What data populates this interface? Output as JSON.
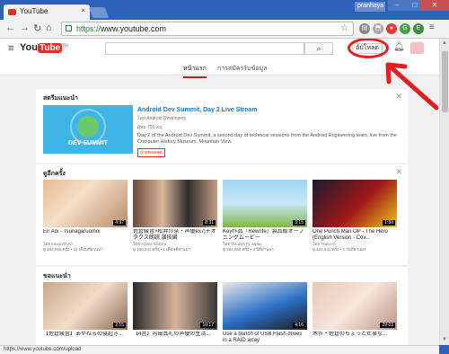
{
  "browser": {
    "tab_title": "YouTube",
    "tab_close": "×",
    "user_name": "pranhaya",
    "url_scheme": "https://",
    "url_rest": "www.youtube.com",
    "status_url": "https://www.youtube.com/upload",
    "window_minimize": "–",
    "window_maximize": "□",
    "window_close": "✕"
  },
  "masthead": {
    "logo_you": "You",
    "logo_tube": "Tube",
    "logo_country": "TH",
    "search_placeholder": "",
    "upload_label": "อัปโหลด"
  },
  "subnav": {
    "home": "หน้าแรก",
    "subscriptions": "การสมัครรับข้อมูล"
  },
  "recommended": {
    "title": "สตรีมแนะนำ",
    "featured": {
      "thumb_label": "DEV SUMMIT",
      "title": "Android Dev Summit, Day 2 Live Stream",
      "channel": "โดย Android Developers",
      "views": "ผู้ชม 756 คน",
      "description": "Day 2 of the Android Dev Summit, a second day of technical sessions from the Android Engineering team, live from the Computer History Museum, Mountain View.",
      "badge": "ถ่ายทอดสด"
    }
  },
  "watch_again": {
    "title": "ดูอีกครั้ง",
    "videos": [
      {
        "title": "Eir Aoi - Tsunagaruomoi",
        "channel": "โดย eiraoiVEVO",
        "meta": "ดู 282,585 ครั้ง • 10 เดือนที่ผ่านมา",
        "duration": "4:37"
      },
      {
        "title": "佐倉綾音×松井玲奈・声優ex7|チオタクス朗読 演技編",
        "channel": "โดย Ayane Sakura",
        "meta": "ดู 190,342 ครั้ง • 1 เดือนที่ผ่านมา",
        "duration": "8:31"
      },
      {
        "title": "Key作品『Rewrite』製品版オープニングムービー",
        "channel": "โดย VisualArt's Japan",
        "meta": "ดู 382,002 ครั้ง • 4 ปีที่ผ่านมา",
        "duration": "3:15"
      },
      {
        "title": "One Punch Man OP - The Hero (English Version - Cov...",
        "channel": "โดย Tsuko G",
        "meta": "ดู 142,631 ครั้ง • 3 วันที่ผ่านมา",
        "duration": "1:30"
      }
    ]
  },
  "recommended_videos": {
    "title": "ขอแนะนำ",
    "videos": [
      {
        "title": "【佐倉綾音】あやねるの寝起き...",
        "duration": "2:15"
      },
      {
        "title": "【4音】内田真礼の声優の生活...",
        "duration": "10:17"
      },
      {
        "title": "Use a bunch of USB Flash drives in a RAID array",
        "duration": "4:16"
      },
      {
        "title": "木作・佐倉のちょっと仕事な...",
        "duration": "29:03"
      }
    ]
  },
  "colors": {
    "accent": "#cc181e",
    "link": "#167ac6",
    "annotation": "#e31e1e"
  }
}
